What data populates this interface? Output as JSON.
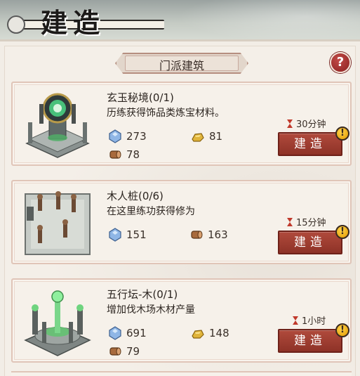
{
  "header": {
    "title": "建造"
  },
  "section": {
    "title": "门派建筑",
    "help_symbol": "?"
  },
  "buildings": [
    {
      "name": "玄玉秘境(0/1)",
      "description": "历练获得饰品类炼宝材料。",
      "resources": [
        {
          "icon": "jade-crystal-icon",
          "value": "273"
        },
        {
          "icon": "gold-ingot-icon",
          "value": "81"
        },
        {
          "icon": "wood-log-icon",
          "value": "78"
        }
      ],
      "time": "30分钟",
      "button": "建造"
    },
    {
      "name": "木人桩(0/6)",
      "description": "在这里练功获得修为",
      "resources": [
        {
          "icon": "jade-crystal-icon",
          "value": "151"
        },
        {
          "icon": "wood-log-icon",
          "value": "163"
        }
      ],
      "time": "15分钟",
      "button": "建造"
    },
    {
      "name": "五行坛-木(0/1)",
      "description": "增加伐木场木材产量",
      "resources": [
        {
          "icon": "jade-crystal-icon",
          "value": "691"
        },
        {
          "icon": "gold-ingot-icon",
          "value": "148"
        },
        {
          "icon": "wood-log-icon",
          "value": "79"
        }
      ],
      "time": "1小时",
      "button": "建造"
    }
  ],
  "colors": {
    "button_red": "#9e3d31",
    "alert_yellow": "#f2b619",
    "card_border": "#e0c5b8"
  }
}
